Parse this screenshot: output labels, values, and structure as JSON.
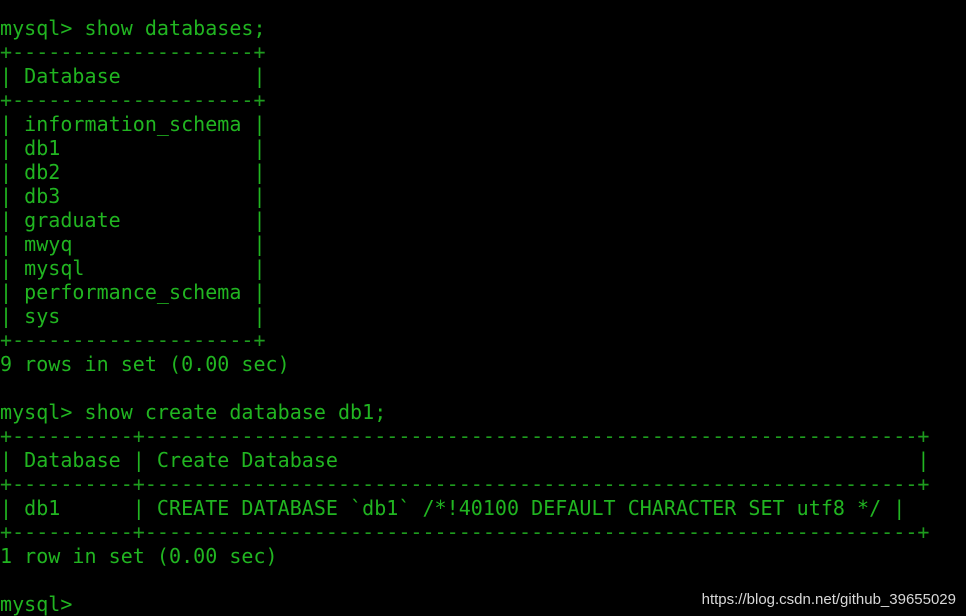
{
  "terminal": {
    "lines": [
      "mysql> show databases;",
      "+--------------------+",
      "| Database           |",
      "+--------------------+",
      "| information_schema |",
      "| db1                |",
      "| db2                |",
      "| db3                |",
      "| graduate           |",
      "| mwyq               |",
      "| mysql              |",
      "| performance_schema |",
      "| sys                |",
      "+--------------------+",
      "9 rows in set (0.00 sec)",
      "",
      "mysql> show create database db1;",
      "+----------+----------------------------------------------------------------+",
      "| Database | Create Database                                                |",
      "+----------+----------------------------------------------------------------+",
      "| db1      | CREATE DATABASE `db1` /*!40100 DEFAULT CHARACTER SET utf8 */ |",
      "+----------+----------------------------------------------------------------+",
      "1 row in set (0.00 sec)",
      "",
      "mysql>"
    ]
  },
  "watermark": "https://blog.csdn.net/github_39655029",
  "colors": {
    "background": "#000000",
    "text": "#21b521",
    "watermark": "#d8d8d8"
  }
}
